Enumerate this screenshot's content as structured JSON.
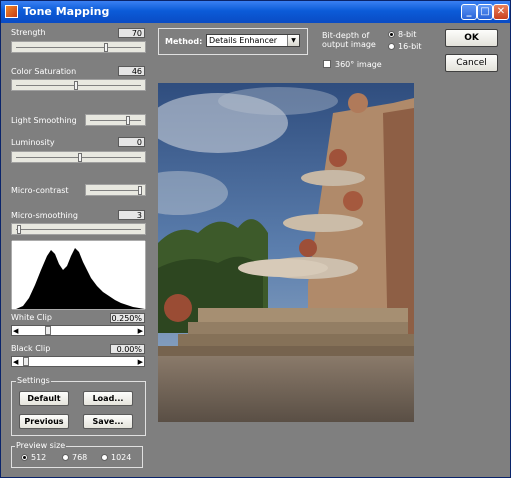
{
  "window": {
    "title": "Tone Mapping"
  },
  "sliders": {
    "strength": {
      "label": "Strength",
      "value": "70"
    },
    "color_saturation": {
      "label": "Color Saturation",
      "value": "46"
    },
    "light_smoothing": {
      "label": "Light Smoothing"
    },
    "luminosity": {
      "label": "Luminosity",
      "value": "0"
    },
    "micro_contrast": {
      "label": "Micro-contrast"
    },
    "micro_smoothing": {
      "label": "Micro-smoothing",
      "value": "3"
    }
  },
  "clips": {
    "white": {
      "label": "White Clip",
      "value": "0.250%"
    },
    "black": {
      "label": "Black Clip",
      "value": "0.00%"
    }
  },
  "method": {
    "label": "Method:",
    "selected": "Details Enhancer"
  },
  "bit_depth": {
    "label_line1": "Bit-depth of",
    "label_line2": "output image",
    "opt_8": "8-bit",
    "opt_16": "16-bit"
  },
  "option_360": {
    "label": "360° image",
    "checked": false
  },
  "buttons": {
    "ok": "OK",
    "cancel": "Cancel"
  },
  "settings": {
    "group_label": "Settings",
    "default": "Default",
    "load": "Load...",
    "previous": "Previous",
    "save": "Save..."
  },
  "preview_size": {
    "group_label": "Preview size",
    "options": [
      "512",
      "768",
      "1024"
    ],
    "selected": "512"
  },
  "colors": {
    "title_bar": "#0b5bd8",
    "background": "#7f7f7f",
    "histogram": "#000000"
  },
  "icons": [
    "minimize-icon",
    "maximize-icon",
    "close-icon",
    "dropdown-arrow-icon"
  ]
}
